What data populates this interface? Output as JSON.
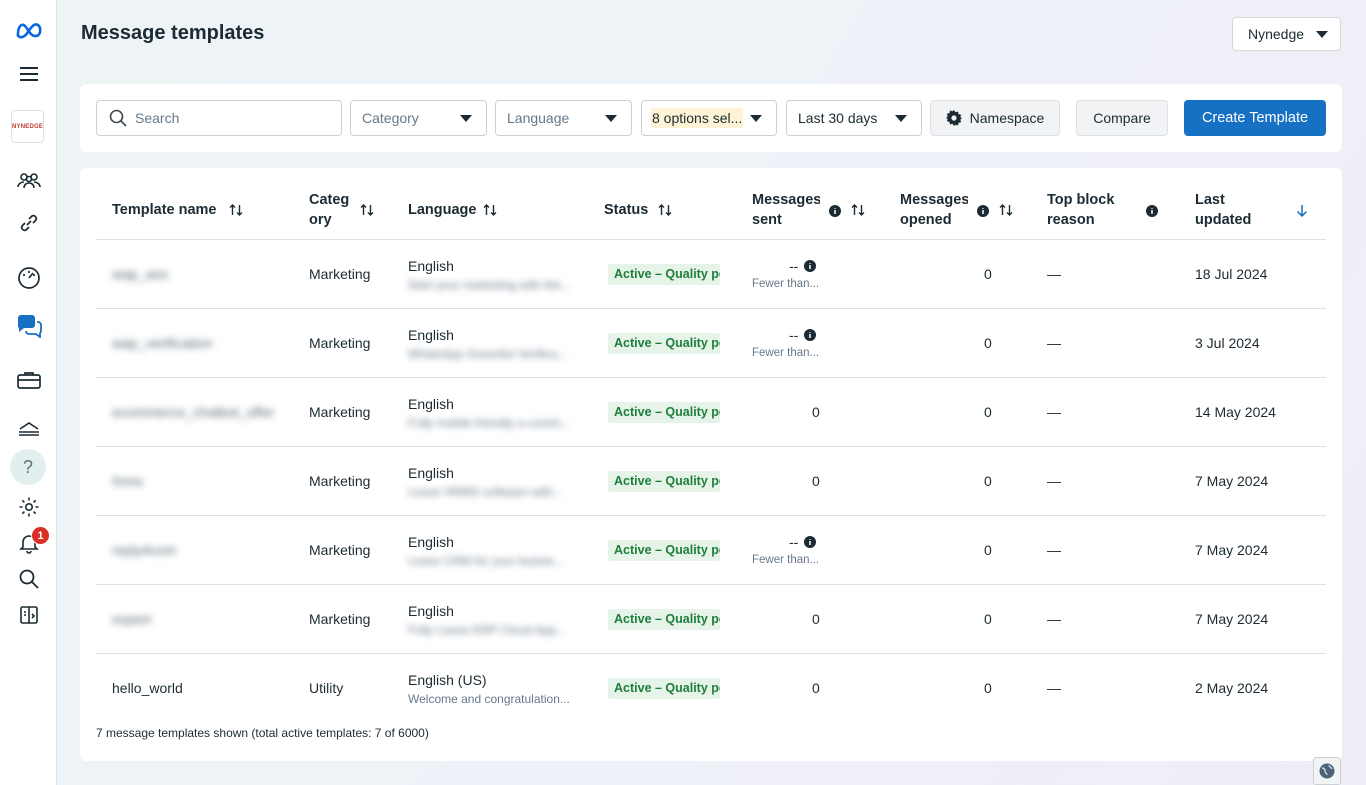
{
  "page": {
    "title": "Message templates",
    "account": "Nynedge"
  },
  "sidebar": {
    "brand_logo_text": "NYNEDGE",
    "notification_count": "1",
    "help_glyph": "?",
    "icons": [
      "meta-logo-icon",
      "menu-icon",
      "people-icon",
      "link-icon",
      "dashboard-icon",
      "chat-icon",
      "briefcase-icon",
      "inbox-icon",
      "help-icon",
      "settings-icon",
      "bell-icon",
      "search-icon",
      "panel-icon"
    ]
  },
  "toolbar": {
    "search_placeholder": "Search",
    "category_placeholder": "Category",
    "language_placeholder": "Language",
    "status_filter": "8 options sel...",
    "date_range": "Last 30 days",
    "namespace_label": "Namespace",
    "compare_label": "Compare",
    "create_label": "Create Template"
  },
  "table": {
    "headers": {
      "name": "Template name",
      "category": [
        "Categ",
        "ory"
      ],
      "language": "Language",
      "status": "Status",
      "sent": [
        "Messages",
        "sent"
      ],
      "opened": [
        "Messages",
        "opened"
      ],
      "block": [
        "Top block",
        "reason"
      ],
      "updated": [
        "Last",
        "updated"
      ]
    },
    "rows": [
      {
        "name": "wap_seo",
        "name_blurred": true,
        "category": "Marketing",
        "language": "English",
        "lang_sub": "Start your marketing with the...",
        "lang_sub_blurred": true,
        "status": "Active – Quality pending",
        "sent": "--",
        "sent_note": "Fewer than...",
        "opened": "0",
        "block": "—",
        "updated": "18 Jul 2024"
      },
      {
        "name": "wap_verification",
        "name_blurred": true,
        "category": "Marketing",
        "language": "English",
        "lang_sub": "WhatsApp Greenlist Verifica...",
        "lang_sub_blurred": true,
        "status": "Active – Quality pending",
        "sent": "--",
        "sent_note": "Fewer than...",
        "opened": "0",
        "block": "—",
        "updated": "3 Jul 2024"
      },
      {
        "name": "ecommerce_chatbot_offer",
        "name_blurred": true,
        "category": "Marketing",
        "language": "English",
        "lang_sub": "Fully mobile friendly e-comm...",
        "lang_sub_blurred": true,
        "status": "Active – Quality pending",
        "sent": "0",
        "sent_note": "",
        "opened": "0",
        "block": "—",
        "updated": "14 May 2024"
      },
      {
        "name": "hrms",
        "name_blurred": true,
        "category": "Marketing",
        "language": "English",
        "lang_sub": "Leave HRMS software with...",
        "lang_sub_blurred": true,
        "status": "Active – Quality pending",
        "sent": "0",
        "sent_note": "",
        "opened": "0",
        "block": "—",
        "updated": "7 May 2024"
      },
      {
        "name": "reply4com",
        "name_blurred": true,
        "category": "Marketing",
        "language": "English",
        "lang_sub": "Leave CRM for your busine...",
        "lang_sub_blurred": true,
        "status": "Active – Quality pending",
        "sent": "--",
        "sent_note": "Fewer than...",
        "opened": "0",
        "block": "—",
        "updated": "7 May 2024"
      },
      {
        "name": "expert",
        "name_blurred": true,
        "category": "Marketing",
        "language": "English",
        "lang_sub": "Fully Leave ERP Cloud App...",
        "lang_sub_blurred": true,
        "status": "Active – Quality pending",
        "sent": "0",
        "sent_note": "",
        "opened": "0",
        "block": "—",
        "updated": "7 May 2024"
      },
      {
        "name": "hello_world",
        "name_blurred": false,
        "category": "Utility",
        "language": "English (US)",
        "lang_sub": "Welcome and congratulation...",
        "lang_sub_blurred": false,
        "status": "Active – Quality pending",
        "sent": "0",
        "sent_note": "",
        "opened": "0",
        "block": "—",
        "updated": "2 May 2024"
      }
    ],
    "footer": "7 message templates shown (total active templates: 7 of 6000)"
  },
  "colors": {
    "primary": "#1670c4",
    "status_green": "#1d7f3a",
    "status_bg": "#e6f3e9",
    "badge_red": "#d93025",
    "meta_blue": "#0668e1"
  }
}
